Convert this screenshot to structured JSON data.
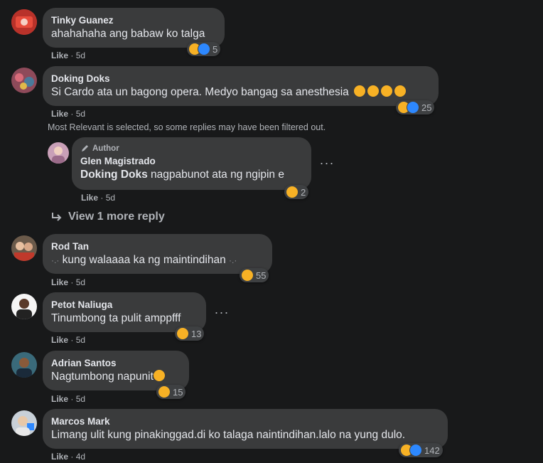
{
  "comments": [
    {
      "name": "Tinky Guanez",
      "text": "ahahahaha ang babaw ko talga",
      "react_count": "5",
      "like": "Like",
      "time": "5d"
    },
    {
      "name": "Doking Doks",
      "text": "Si Cardo ata un bagong opera. Medyo bangag sa anesthesia",
      "react_count": "25",
      "like": "Like",
      "time": "5d"
    },
    {
      "name": "Rod Tan",
      "text": "kung walaaaa ka ng maintindihan",
      "react_count": "55",
      "like": "Like",
      "time": "5d"
    },
    {
      "name": "Petot Naliuga",
      "text": "Tinumbong ta pulit amppfff",
      "react_count": "13",
      "like": "Like",
      "time": "5d"
    },
    {
      "name": "Adrian Santos",
      "text": "Nagtumbong napunit",
      "react_count": "15",
      "like": "Like",
      "time": "5d"
    },
    {
      "name": "Marcos Mark",
      "text": "Limang ulit kung pinakinggad.di ko talaga naintindihan.lalo na yung dulo.",
      "react_count": "142",
      "like": "Like",
      "time": "4d"
    }
  ],
  "filter_note": "Most Relevant is selected, so some replies may have been filtered out.",
  "reply": {
    "badge": "Author",
    "name": "Glen Magistrado",
    "mention": "Doking Doks",
    "text": "nagpabunot ata ng ngipin e",
    "react_count": "2",
    "like": "Like",
    "time": "5d"
  },
  "view_more": "View 1 more reply",
  "colors": {
    "background": "#18191a",
    "bubble": "#3a3b3c",
    "haha": "#f7b125",
    "like": "#2d88ff"
  },
  "icons": [
    "haha-reaction-icon",
    "like-reaction-icon",
    "more-options-icon",
    "reply-arrow-icon",
    "pencil-icon"
  ]
}
